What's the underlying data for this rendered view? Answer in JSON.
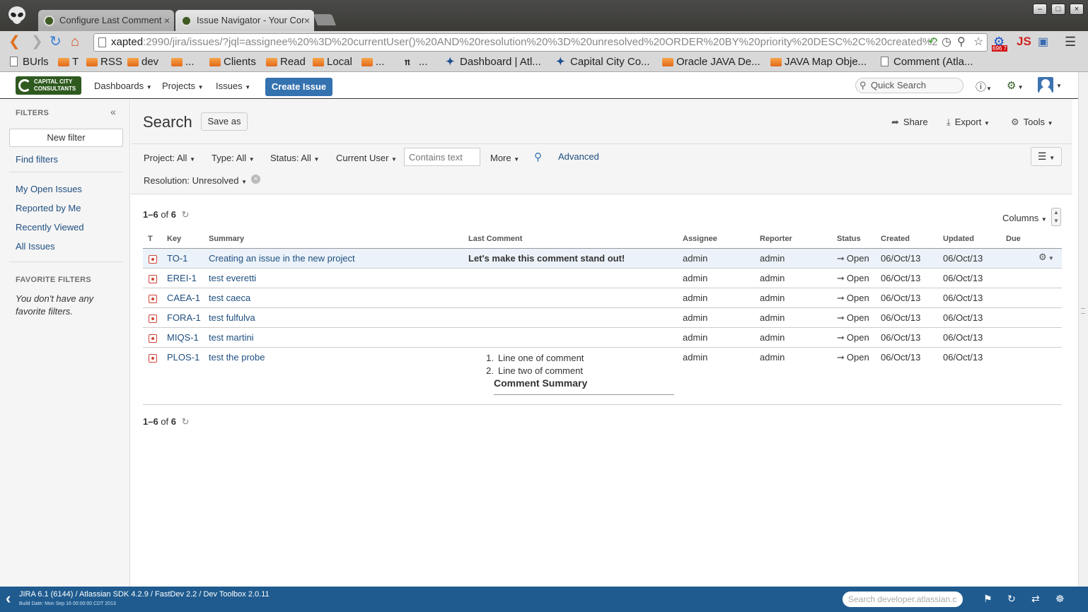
{
  "browser": {
    "tabs": [
      {
        "title": "Configure Last Comment",
        "close": "×"
      },
      {
        "title": "Issue Navigator - Your Cor",
        "close": "×"
      }
    ],
    "url": {
      "host": "xapted",
      "rest": ":2990/jira/issues/?jql=assignee%20%3D%20currentUser()%20AND%20resolution%20%3D%20unresolved%20ORDER%20BY%20priority%20DESC%2C%20created%2"
    },
    "extension_badge": "696 7",
    "extension_js": "JS",
    "window_buttons": {
      "minimize": "–",
      "maximize": "□",
      "close": "×"
    },
    "bookmarks": [
      {
        "label": "BUrls",
        "icon": "page-icon"
      },
      {
        "label": "T",
        "icon": "folder-icon"
      },
      {
        "label": "RSS",
        "icon": "folder-icon"
      },
      {
        "label": "dev",
        "icon": "folder-icon"
      },
      {
        "label": "...",
        "icon": "folder-icon"
      },
      {
        "label": "Clients",
        "icon": "folder-icon"
      },
      {
        "label": "Read",
        "icon": "folder-icon"
      },
      {
        "label": "Local",
        "icon": "folder-icon"
      },
      {
        "label": "...",
        "icon": "folder-icon"
      },
      {
        "label": "...",
        "icon": "nyt-icon"
      },
      {
        "label": "Dashboard | Atl...",
        "icon": "atlassian-icon"
      },
      {
        "label": "Capital City Co...",
        "icon": "atlassian-icon"
      },
      {
        "label": "Oracle JAVA De...",
        "icon": "folder-icon"
      },
      {
        "label": "JAVA Map Obje...",
        "icon": "folder-icon"
      },
      {
        "label": "Comment (Atla...",
        "icon": "page-icon"
      }
    ]
  },
  "header": {
    "logo_line1": "CAPITAL CITY",
    "logo_line2": "CONSULTANTS",
    "nav": [
      "Dashboards",
      "Projects",
      "Issues"
    ],
    "create_label": "Create Issue",
    "quick_search_placeholder": "Quick Search"
  },
  "sidebar": {
    "filters_heading": "FILTERS",
    "new_filter": "New filter",
    "find_filters": "Find filters",
    "links": [
      "My Open Issues",
      "Reported by Me",
      "Recently Viewed",
      "All Issues"
    ],
    "favorites_heading": "FAVORITE FILTERS",
    "favorites_empty": "You don't have any favorite filters."
  },
  "search": {
    "title": "Search",
    "save_as": "Save as",
    "actions": {
      "share": "Share",
      "export": "Export",
      "tools": "Tools"
    },
    "criteria": {
      "project_label": "Project:",
      "project_value": "All",
      "type_label": "Type:",
      "type_value": "All",
      "status_label": "Status:",
      "status_value": "All",
      "user": "Current User",
      "text_placeholder": "Contains text",
      "more": "More",
      "advanced": "Advanced",
      "resolution_label": "Resolution:",
      "resolution_value": "Unresolved"
    }
  },
  "results": {
    "range": "1–6",
    "of": "of",
    "total": "6",
    "columns_label": "Columns",
    "headers": {
      "t": "T",
      "key": "Key",
      "summary": "Summary",
      "last_comment": "Last Comment",
      "assignee": "Assignee",
      "reporter": "Reporter",
      "status": "Status",
      "created": "Created",
      "updated": "Updated",
      "due": "Due"
    },
    "rows": [
      {
        "key": "TO-1",
        "summary": "Creating an issue in the new project",
        "comment": "Let's make this comment stand out!",
        "assignee": "admin",
        "reporter": "admin",
        "status": "Open",
        "created": "06/Oct/13",
        "updated": "06/Oct/13"
      },
      {
        "key": "EREI-1",
        "summary": "test everetti",
        "comment": "",
        "assignee": "admin",
        "reporter": "admin",
        "status": "Open",
        "created": "06/Oct/13",
        "updated": "06/Oct/13"
      },
      {
        "key": "CAEA-1",
        "summary": "test caeca",
        "comment": "",
        "assignee": "admin",
        "reporter": "admin",
        "status": "Open",
        "created": "06/Oct/13",
        "updated": "06/Oct/13"
      },
      {
        "key": "FORA-1",
        "summary": "test fulfulva",
        "comment": "",
        "assignee": "admin",
        "reporter": "admin",
        "status": "Open",
        "created": "06/Oct/13",
        "updated": "06/Oct/13"
      },
      {
        "key": "MIQS-1",
        "summary": "test martini",
        "comment": "",
        "assignee": "admin",
        "reporter": "admin",
        "status": "Open",
        "created": "06/Oct/13",
        "updated": "06/Oct/13"
      },
      {
        "key": "PLOS-1",
        "summary": "test the probe",
        "comment": "",
        "assignee": "admin",
        "reporter": "admin",
        "status": "Open",
        "created": "06/Oct/13",
        "updated": "06/Oct/13"
      }
    ],
    "last_row_comment": {
      "items": [
        {
          "num": "1.",
          "text": "Line one of comment"
        },
        {
          "num": "2.",
          "text": "Line two of comment"
        }
      ],
      "summary": "Comment Summary"
    }
  },
  "devbar": {
    "version": "JIRA 6.1 (6144) / Atlassian SDK 4.2.9 / FastDev 2.2 / Dev Toolbox 2.0.11",
    "build": "Build Date: Mon Sep 16 00:00:00 CDT 2013",
    "search_placeholder": "Search developer.atlassian.c"
  }
}
